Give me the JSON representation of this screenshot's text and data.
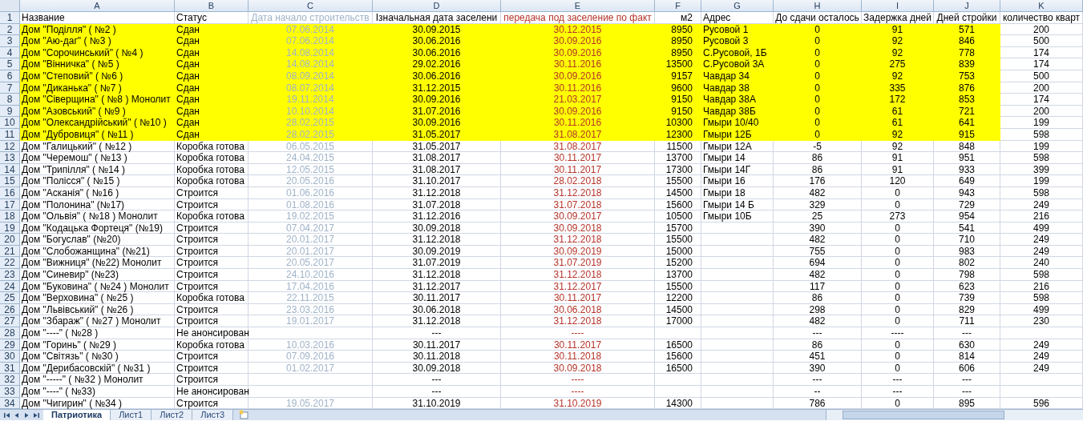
{
  "columns": [
    {
      "letter": "A",
      "color": "#000000"
    },
    {
      "letter": "B",
      "color": "#000000"
    },
    {
      "letter": "C",
      "color": "#9fb3c8"
    },
    {
      "letter": "D",
      "color": "#000000"
    },
    {
      "letter": "E",
      "color": "#b5342a"
    },
    {
      "letter": "F",
      "color": "#000000"
    },
    {
      "letter": "G",
      "color": "#000000"
    },
    {
      "letter": "H",
      "color": "#000000"
    },
    {
      "letter": "I",
      "color": "#000000"
    },
    {
      "letter": "J",
      "color": "#000000"
    },
    {
      "letter": "K",
      "color": "#000000"
    }
  ],
  "rows": [
    {
      "number": "1",
      "highlighted": false,
      "cells": [
        "Название",
        "Статус",
        "Дата начало строительств",
        "Ізначальная дата заселени",
        "передача под заселение по факт",
        "м2",
        "Адрес",
        "До сдачи осталось",
        "Задержка дней",
        "Дней стройки",
        "количество кварт"
      ]
    },
    {
      "number": "2",
      "highlighted": true,
      "cells": [
        "Дом \"Поділля\" ( №2 )",
        "Сдан",
        "07.06.2014",
        "30.09.2015",
        "30.12.2015",
        "8950",
        "Русовой 1",
        "0",
        "91",
        "571",
        "200"
      ]
    },
    {
      "number": "3",
      "highlighted": true,
      "cells": [
        "Дом \"Аю-даг\" ( №3 )",
        "Сдан",
        "07.06.2014",
        "30.06.2016",
        "30.09.2016",
        "8950",
        "Русовой 3",
        "0",
        "92",
        "846",
        "500"
      ]
    },
    {
      "number": "4",
      "highlighted": true,
      "cells": [
        "Дом \"Сорочинський\" ( №4 )",
        "Сдан",
        "14.08.2014",
        "30.06.2016",
        "30.09.2016",
        "8950",
        "С.Русовой, 1Б",
        "0",
        "92",
        "778",
        "174"
      ]
    },
    {
      "number": "5",
      "highlighted": true,
      "cells": [
        "Дом \"Вінничка\" ( №5 )",
        "Сдан",
        "14.08.2014",
        "29.02.2016",
        "30.11.2016",
        "13500",
        "С.Русовой 3А",
        "0",
        "275",
        "839",
        "174"
      ]
    },
    {
      "number": "6",
      "highlighted": true,
      "cells": [
        "Дом \"Степовий\" ( №6 )",
        "Сдан",
        "08.09.2014",
        "30.06.2016",
        "30.09.2016",
        "9157",
        "Чавдар 34",
        "0",
        "92",
        "753",
        "500"
      ]
    },
    {
      "number": "7",
      "highlighted": true,
      "cells": [
        "Дом \"Диканька\" ( №7 )",
        "Сдан",
        "08.07.2014",
        "31.12.2015",
        "30.11.2016",
        "9600",
        "Чавдар 38",
        "0",
        "335",
        "876",
        "200"
      ]
    },
    {
      "number": "8",
      "highlighted": true,
      "cells": [
        "Дом \"Сіверщина\" ( №8 ) Монолит",
        "Сдан",
        "19.11.2014",
        "30.09.2016",
        "21.03.2017",
        "9150",
        "Чавдар 38А",
        "0",
        "172",
        "853",
        "174"
      ]
    },
    {
      "number": "9",
      "highlighted": true,
      "cells": [
        "Дом \"Азовський\" ( №9 )",
        "Сдан",
        "10.10.2014",
        "31.07.2016",
        "30.09.2016",
        "9150",
        "Чавдар 38Б",
        "0",
        "61",
        "721",
        "200"
      ]
    },
    {
      "number": "10",
      "highlighted": true,
      "cells": [
        "Дом \"Олександрійський\" ( №10 )",
        "Сдан",
        "28.02.2015",
        "30.09.2016",
        "30.11.2016",
        "10300",
        "Гмыри 10/40",
        "0",
        "61",
        "641",
        "199"
      ]
    },
    {
      "number": "11",
      "highlighted": true,
      "cells": [
        "Дом \"Дубровиця\" ( №11 )",
        "Сдан",
        "28.02.2015",
        "31.05.2017",
        "31.08.2017",
        "12300",
        "Гмыри 12Б",
        "0",
        "92",
        "915",
        "598"
      ]
    },
    {
      "number": "12",
      "highlighted": false,
      "cells": [
        "Дом \"Галицький\" ( №12 )",
        "Коробка готова",
        "06.05.2015",
        "31.05.2017",
        "31.08.2017",
        "11500",
        "Гмыри 12А",
        "-5",
        "92",
        "848",
        "199"
      ]
    },
    {
      "number": "13",
      "highlighted": false,
      "cells": [
        "Дом \"Черемош\" ( №13 )",
        "Коробка готова",
        "24.04.2015",
        "31.08.2017",
        "30.11.2017",
        "13700",
        "Гмыри 14",
        "86",
        "91",
        "951",
        "598"
      ]
    },
    {
      "number": "14",
      "highlighted": false,
      "cells": [
        "Дом \"Трипілля\" ( №14 )",
        "Коробка готова",
        "12.05.2015",
        "31.08.2017",
        "30.11.2017",
        "17300",
        "Гмыри 14Г",
        "86",
        "91",
        "933",
        "399"
      ]
    },
    {
      "number": "15",
      "highlighted": false,
      "cells": [
        "Дом \"Полісся\" ( №15 )",
        "Коробка готова",
        "20.05.2016",
        "31.10.2017",
        "28.02.2018",
        "15500",
        "Гмыри 16",
        "176",
        "120",
        "649",
        "199"
      ]
    },
    {
      "number": "16",
      "highlighted": false,
      "cells": [
        "Дом \"Асканія\" ( №16 )",
        "Строится",
        "01.06.2016",
        "31.12.2018",
        "31.12.2018",
        "14500",
        "Гмыри 18",
        "482",
        "0",
        "943",
        "598"
      ]
    },
    {
      "number": "17",
      "highlighted": false,
      "cells": [
        "Дом \"Полонина\" (№17)",
        "Строится",
        "01.08.2016",
        "31.07.2018",
        "31.07.2018",
        "15600",
        "Гмыри 14 Б",
        "329",
        "0",
        "729",
        "249"
      ]
    },
    {
      "number": "18",
      "highlighted": false,
      "cells": [
        "Дом \"Ольвія\" ( №18 ) Монолит",
        "Коробка готова",
        "19.02.2015",
        "31.12.2016",
        "30.09.2017",
        "10500",
        "Гмыри 10Б",
        "25",
        "273",
        "954",
        "216"
      ]
    },
    {
      "number": "19",
      "highlighted": false,
      "cells": [
        "Дом \"Кодацька Фортеця\" (№19)",
        "Строится",
        "07.04.2017",
        "30.09.2018",
        "30.09.2018",
        "15700",
        null,
        "390",
        "0",
        "541",
        "499"
      ]
    },
    {
      "number": "20",
      "highlighted": false,
      "cells": [
        "Дом \"Богуслав\" (№20)",
        "Строится",
        "20.01.2017",
        "31.12.2018",
        "31.12.2018",
        "15500",
        null,
        "482",
        "0",
        "710",
        "249"
      ]
    },
    {
      "number": "21",
      "highlighted": false,
      "cells": [
        "Дом \"Слобожанщина\" (№21)",
        "Строится",
        "20.01.2017",
        "30.09.2019",
        "30.09.2019",
        "15000",
        null,
        "755",
        "0",
        "983",
        "249"
      ]
    },
    {
      "number": "22",
      "highlighted": false,
      "cells": [
        "Дом \"Вижниця\" (№22) Монолит",
        "Строится",
        "20.05.2017",
        "31.07.2019",
        "31.07.2019",
        "15200",
        null,
        "694",
        "0",
        "802",
        "240"
      ]
    },
    {
      "number": "23",
      "highlighted": false,
      "cells": [
        "Дом \"Синевир\" (№23)",
        "Строится",
        "24.10.2016",
        "31.12.2018",
        "31.12.2018",
        "13700",
        null,
        "482",
        "0",
        "798",
        "598"
      ]
    },
    {
      "number": "24",
      "highlighted": false,
      "cells": [
        "Дом \"Буковина\" ( №24 ) Монолит",
        "Строится",
        "17.04.2016",
        "31.12.2017",
        "31.12.2017",
        "15500",
        null,
        "117",
        "0",
        "623",
        "216"
      ]
    },
    {
      "number": "25",
      "highlighted": false,
      "cells": [
        "Дом \"Верховина\" ( №25 )",
        "Коробка готова",
        "22.11.2015",
        "30.11.2017",
        "30.11.2017",
        "12200",
        null,
        "86",
        "0",
        "739",
        "598"
      ]
    },
    {
      "number": "26",
      "highlighted": false,
      "cells": [
        "Дом \"Львівський\" ( №26 )",
        "Строится",
        "23.03.2016",
        "30.06.2018",
        "30.06.2018",
        "14500",
        null,
        "298",
        "0",
        "829",
        "499"
      ]
    },
    {
      "number": "27",
      "highlighted": false,
      "cells": [
        "Дом \"Збараж\" ( №27 ) Монолит",
        "Строится",
        "19.01.2017",
        "31.12.2018",
        "31.12.2018",
        "17000",
        null,
        "482",
        "0",
        "711",
        "230"
      ]
    },
    {
      "number": "28",
      "highlighted": false,
      "cells": [
        "Дом \"----\" ( №28 )",
        "Не анонсирован",
        null,
        "---",
        "----",
        null,
        null,
        "---",
        "----",
        "---",
        null
      ]
    },
    {
      "number": "29",
      "highlighted": false,
      "cells": [
        "Дом \"Горинь\" ( №29 )",
        "Коробка готова",
        "10.03.2016",
        "30.11.2017",
        "30.11.2017",
        "16500",
        null,
        "86",
        "0",
        "630",
        "249"
      ]
    },
    {
      "number": "30",
      "highlighted": false,
      "cells": [
        "Дом \"Світязь\" ( №30 )",
        "Строится",
        "07.09.2016",
        "30.11.2018",
        "30.11.2018",
        "15600",
        null,
        "451",
        "0",
        "814",
        "249"
      ]
    },
    {
      "number": "31",
      "highlighted": false,
      "cells": [
        "Дом \"Дерибасовскій\" ( №31 )",
        "Строится",
        "01.02.2017",
        "30.09.2018",
        "30.09.2018",
        "16500",
        null,
        "390",
        "0",
        "606",
        "249"
      ]
    },
    {
      "number": "32",
      "highlighted": false,
      "cells": [
        "Дом \"-----\" ( №32 ) Монолит",
        "Строится",
        null,
        "---",
        "----",
        null,
        null,
        "---",
        "---",
        "---",
        null
      ]
    },
    {
      "number": "33",
      "highlighted": false,
      "cells": [
        "Дом \"----\" ( №33)",
        "Не анонсирован",
        null,
        "---",
        "----",
        null,
        null,
        "--",
        "---",
        "---",
        null
      ]
    },
    {
      "number": "34",
      "highlighted": false,
      "cells": [
        "Дом \"Чигирин\"  ( №34 )",
        "Строится",
        "19.05.2017",
        "31.10.2019",
        "31.10.2019",
        "14300",
        null,
        "786",
        "0",
        "895",
        "596"
      ]
    }
  ],
  "sheet_tabs": [
    {
      "label": "Патриотика",
      "selected": true
    },
    {
      "label": "Лист1",
      "selected": false
    },
    {
      "label": "Лист2",
      "selected": false
    },
    {
      "label": "Лист3",
      "selected": false
    }
  ]
}
